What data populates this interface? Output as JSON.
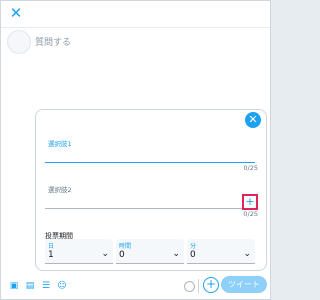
{
  "composer": {
    "question_placeholder": "質問する"
  },
  "poll": {
    "choices": [
      {
        "label": "選択肢1",
        "count": "0/25"
      },
      {
        "label": "選択肢2",
        "count": "0/25"
      }
    ],
    "duration_title": "投票期間",
    "selects": [
      {
        "label": "日",
        "value": "1"
      },
      {
        "label": "時間",
        "value": "0"
      },
      {
        "label": "分",
        "value": "0"
      }
    ]
  },
  "toolbar": {
    "tweet_label": "ツイート"
  },
  "icons": {
    "close": "close-icon",
    "poll_close": "close-icon",
    "add_choice": "plus-icon",
    "image": "image-icon",
    "gif": "gif-icon",
    "poll": "poll-icon",
    "emoji": "emoji-icon",
    "add_tweet": "plus-icon"
  },
  "colors": {
    "accent": "#1da1f2",
    "tweet_disabled": "#8ed0f9",
    "highlight_box": "#e0245e"
  }
}
